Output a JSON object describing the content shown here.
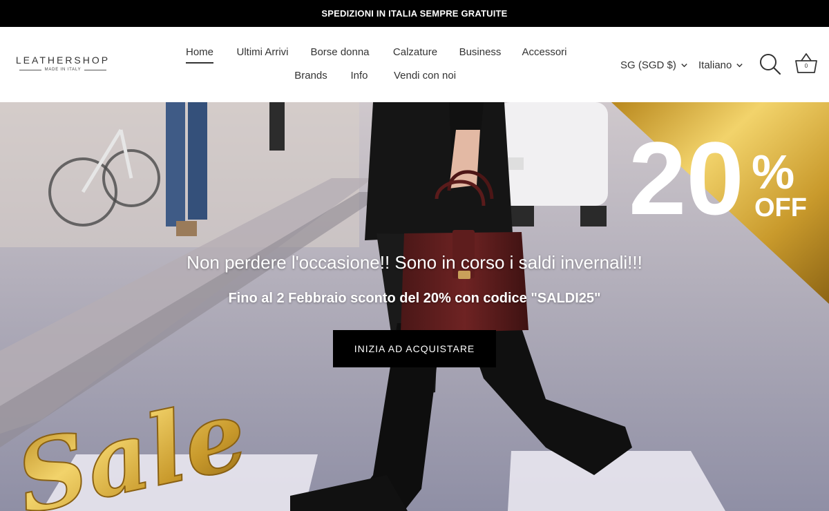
{
  "announcement": {
    "text": "SPEDIZIONI IN ITALIA SEMPRE GRATUITE"
  },
  "logo": {
    "name": "LEATHERSHOP",
    "tagline": "MADE IN ITALY"
  },
  "nav": {
    "row1": [
      "Home",
      "Ultimi Arrivi",
      "Borse donna",
      "Calzature",
      "Business",
      "Accessori"
    ],
    "row2": [
      "Brands",
      "Info",
      "Vendi con noi"
    ],
    "active": "Home"
  },
  "header": {
    "currency": "SG (SGD $)",
    "language": "Italiano",
    "cart_count": "0"
  },
  "icons": {
    "search": "search-icon",
    "cart": "basket-icon",
    "chevron": "chevron-down-icon"
  },
  "hero": {
    "title": "Non perdere l'occasione!! Sono in corso i saldi invernali!!!",
    "subtitle": "Fino al 2 Febbraio sconto del 20% con codice \"SALDI25\"",
    "cta": "INIZIA AD ACQUISTARE",
    "badge_percent": "20",
    "badge_symbol": "%",
    "badge_off": "OFF",
    "sale_script": "Sale"
  },
  "colors": {
    "announcement_bg": "#000000",
    "cta_bg": "#000000",
    "gold": "#c9a227"
  }
}
